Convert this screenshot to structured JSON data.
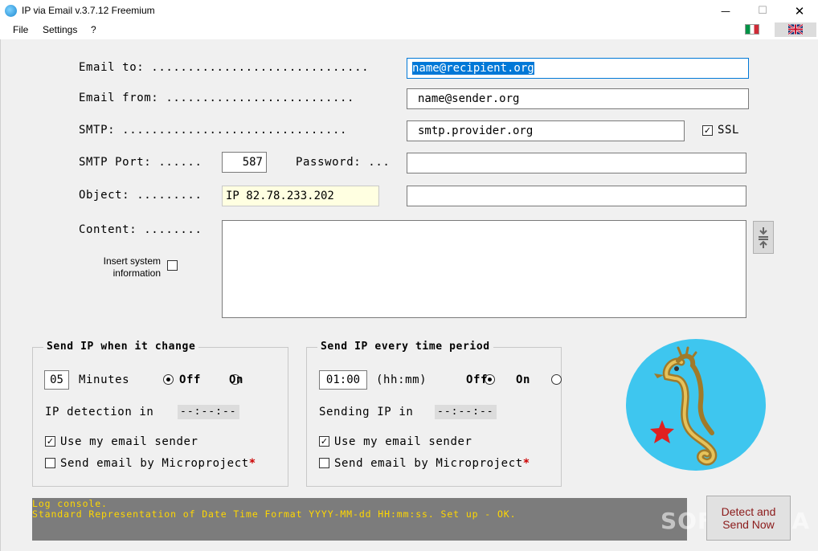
{
  "window": {
    "title": "IP via Email v.3.7.12 Freemium",
    "minimize": "—",
    "maximize": "☐",
    "close": "✕"
  },
  "menu": {
    "file": "File",
    "settings": "Settings",
    "help": "?"
  },
  "form": {
    "email_to_label": "Email to: ..............................",
    "email_to_value": "name@recipient.org",
    "email_from_label": "Email from: ..........................",
    "email_from_value": "name@sender.org",
    "smtp_label": "SMTP: ...............................",
    "smtp_value": "smtp.provider.org",
    "ssl_label": "SSL",
    "ssl_checked": true,
    "smtp_port_label": "SMTP Port: ......",
    "smtp_port_value": "587",
    "password_label": "Password: ...",
    "password_value": "",
    "object_label": "Object: .........",
    "object_value": "IP 82.78.233.202",
    "object_extra_value": "",
    "content_label": "Content: ........",
    "content_value": "",
    "insert_system_info_label_line1": "Insert system",
    "insert_system_info_label_line2": "information"
  },
  "group_change": {
    "title": "Send IP when it change",
    "minutes_value": "05",
    "minutes_label": "Minutes",
    "off_label": "Off",
    "on_label": "On",
    "detection_label": "IP detection in",
    "detection_value": "--:--:--",
    "use_sender_label": "Use my email sender",
    "send_by_micro_label": "Send email by Microproject",
    "asterisk": "*"
  },
  "group_period": {
    "title": "Send IP every time period",
    "time_value": "01:00",
    "time_format": "(hh:mm)",
    "off_label": "Off",
    "on_label": "On",
    "sending_label": "Sending IP in",
    "sending_value": "--:--:--",
    "use_sender_label": "Use my email sender",
    "send_by_micro_label": "Send email by Microproject",
    "asterisk": "*"
  },
  "log": {
    "line1": "Log console.",
    "line2": "Standard Representation of Date Time Format YYYY-MM-dd HH:mm:ss. Set up - OK."
  },
  "send_button": {
    "line1": "Detect and",
    "line2": "Send Now"
  },
  "watermark": "SOFTPEDIA",
  "colors": {
    "accent": "#0078d7",
    "log_bg": "#7c7c7c",
    "log_text": "#ffd700",
    "button_text": "#8b1a1a",
    "logo_bg": "#3ec6ef",
    "object_field_bg": "#ffffe1"
  }
}
